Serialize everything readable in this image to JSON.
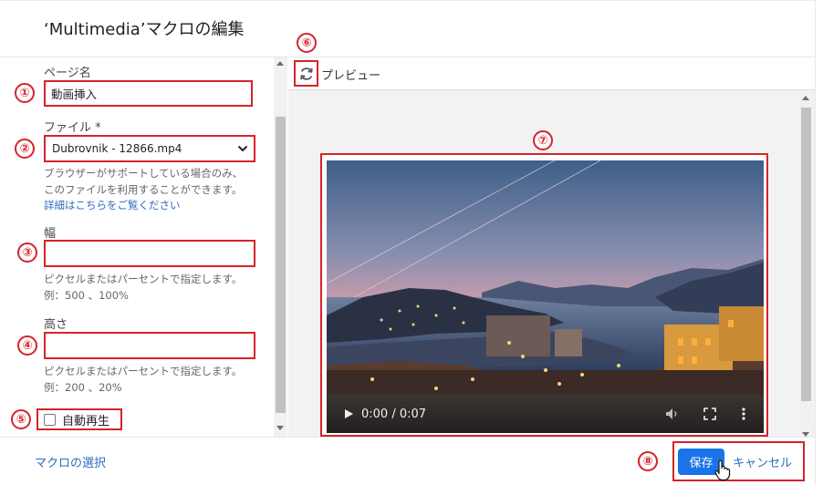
{
  "dialog": {
    "title": "‘Multimedia’マクロの編集"
  },
  "form": {
    "page_name": {
      "label": "ページ名",
      "value": "動画挿入"
    },
    "file": {
      "label": "ファイル *",
      "selected": "Dubrovnik - 12866.mp4",
      "help_line1": "ブラウザーがサポートしている場合のみ、",
      "help_line2": "このファイルを利用することができます。",
      "details_link": "詳細はこちらをご覧ください"
    },
    "width": {
      "label": "幅",
      "value": "",
      "help_line1": "ピクセルまたはパーセントで指定します。",
      "help_line2": "例：500 、100%"
    },
    "height": {
      "label": "高さ",
      "value": "",
      "help_line1": "ピクセルまたはパーセントで指定します。",
      "help_line2": "例：200 、20%"
    },
    "autoplay": {
      "label": "自動再生",
      "checked": false
    }
  },
  "preview": {
    "label": "プレビュー",
    "video": {
      "time": "0:00 / 0:07",
      "progress": 0
    }
  },
  "footer": {
    "macro_select_link": "マクロの選択",
    "save_label": "保存",
    "cancel_label": "キャンセル"
  },
  "annotations": [
    "①",
    "②",
    "③",
    "④",
    "⑤",
    "⑥",
    "⑦",
    "⑧"
  ],
  "colors": {
    "annotation_red": "#d6232a",
    "primary_blue": "#1a73e8",
    "link_blue": "#2d6bbf"
  }
}
